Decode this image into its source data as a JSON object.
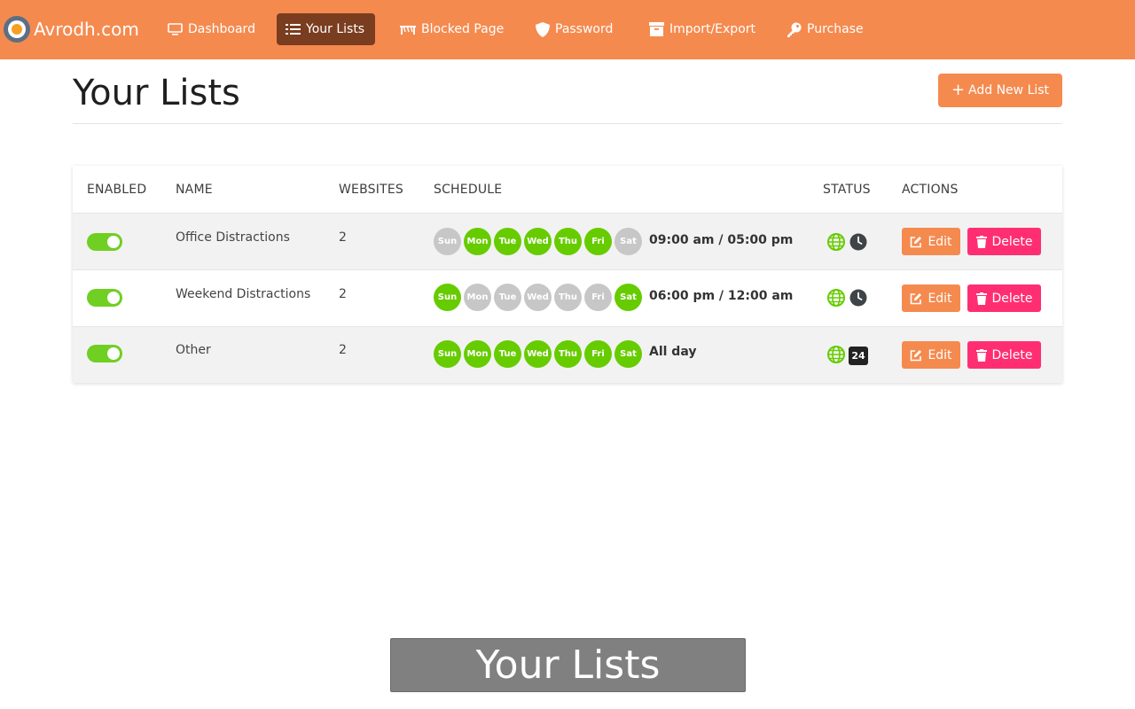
{
  "navbar": {
    "brand": "Avrodh.com",
    "items": [
      {
        "label": "Dashboard",
        "icon": "monitor-icon"
      },
      {
        "label": "Your Lists",
        "icon": "list-icon",
        "active": true
      },
      {
        "label": "Blocked Page",
        "icon": "barrier-icon"
      },
      {
        "label": "Password",
        "icon": "shield-icon"
      },
      {
        "label": "Import/Export",
        "icon": "archive-icon"
      },
      {
        "label": "Purchase",
        "icon": "key-icon"
      }
    ]
  },
  "header": {
    "title": "Your Lists",
    "add_button": "Add New List"
  },
  "table": {
    "columns": [
      "ENABLED",
      "NAME",
      "WEBSITES",
      "SCHEDULE",
      "STATUS",
      "ACTIONS"
    ],
    "rows": [
      {
        "enabled": true,
        "name": "Office Distractions",
        "websites": "2",
        "days": [
          {
            "label": "Sun",
            "on": false
          },
          {
            "label": "Mon",
            "on": true
          },
          {
            "label": "Tue",
            "on": true
          },
          {
            "label": "Wed",
            "on": true
          },
          {
            "label": "Thu",
            "on": true
          },
          {
            "label": "Fri",
            "on": true
          },
          {
            "label": "Sat",
            "on": false
          }
        ],
        "time": "09:00 am / 05:00 pm",
        "status_icons": [
          "globe-icon",
          "clock-icon"
        ]
      },
      {
        "enabled": true,
        "name": "Weekend Distractions",
        "websites": "2",
        "days": [
          {
            "label": "Sun",
            "on": true
          },
          {
            "label": "Mon",
            "on": false
          },
          {
            "label": "Tue",
            "on": false
          },
          {
            "label": "Wed",
            "on": false
          },
          {
            "label": "Thu",
            "on": false
          },
          {
            "label": "Fri",
            "on": false
          },
          {
            "label": "Sat",
            "on": true
          }
        ],
        "time": "06:00 pm / 12:00 am",
        "status_icons": [
          "globe-icon",
          "clock-icon"
        ]
      },
      {
        "enabled": true,
        "name": "Other",
        "websites": "2",
        "days": [
          {
            "label": "Sun",
            "on": true
          },
          {
            "label": "Mon",
            "on": true
          },
          {
            "label": "Tue",
            "on": true
          },
          {
            "label": "Wed",
            "on": true
          },
          {
            "label": "Thu",
            "on": true
          },
          {
            "label": "Fri",
            "on": true
          },
          {
            "label": "Sat",
            "on": true
          }
        ],
        "time": "All day",
        "status_icons": [
          "globe-icon",
          "badge-24-icon"
        ],
        "badge": "24"
      }
    ],
    "edit_label": "Edit",
    "delete_label": "Delete"
  },
  "caption": "Your Lists",
  "colors": {
    "accent": "#f58a4f",
    "active_nav": "#7a3d1f",
    "day_on": "#66cc00",
    "day_off": "#c7c7c7",
    "delete": "#ff2e72"
  }
}
